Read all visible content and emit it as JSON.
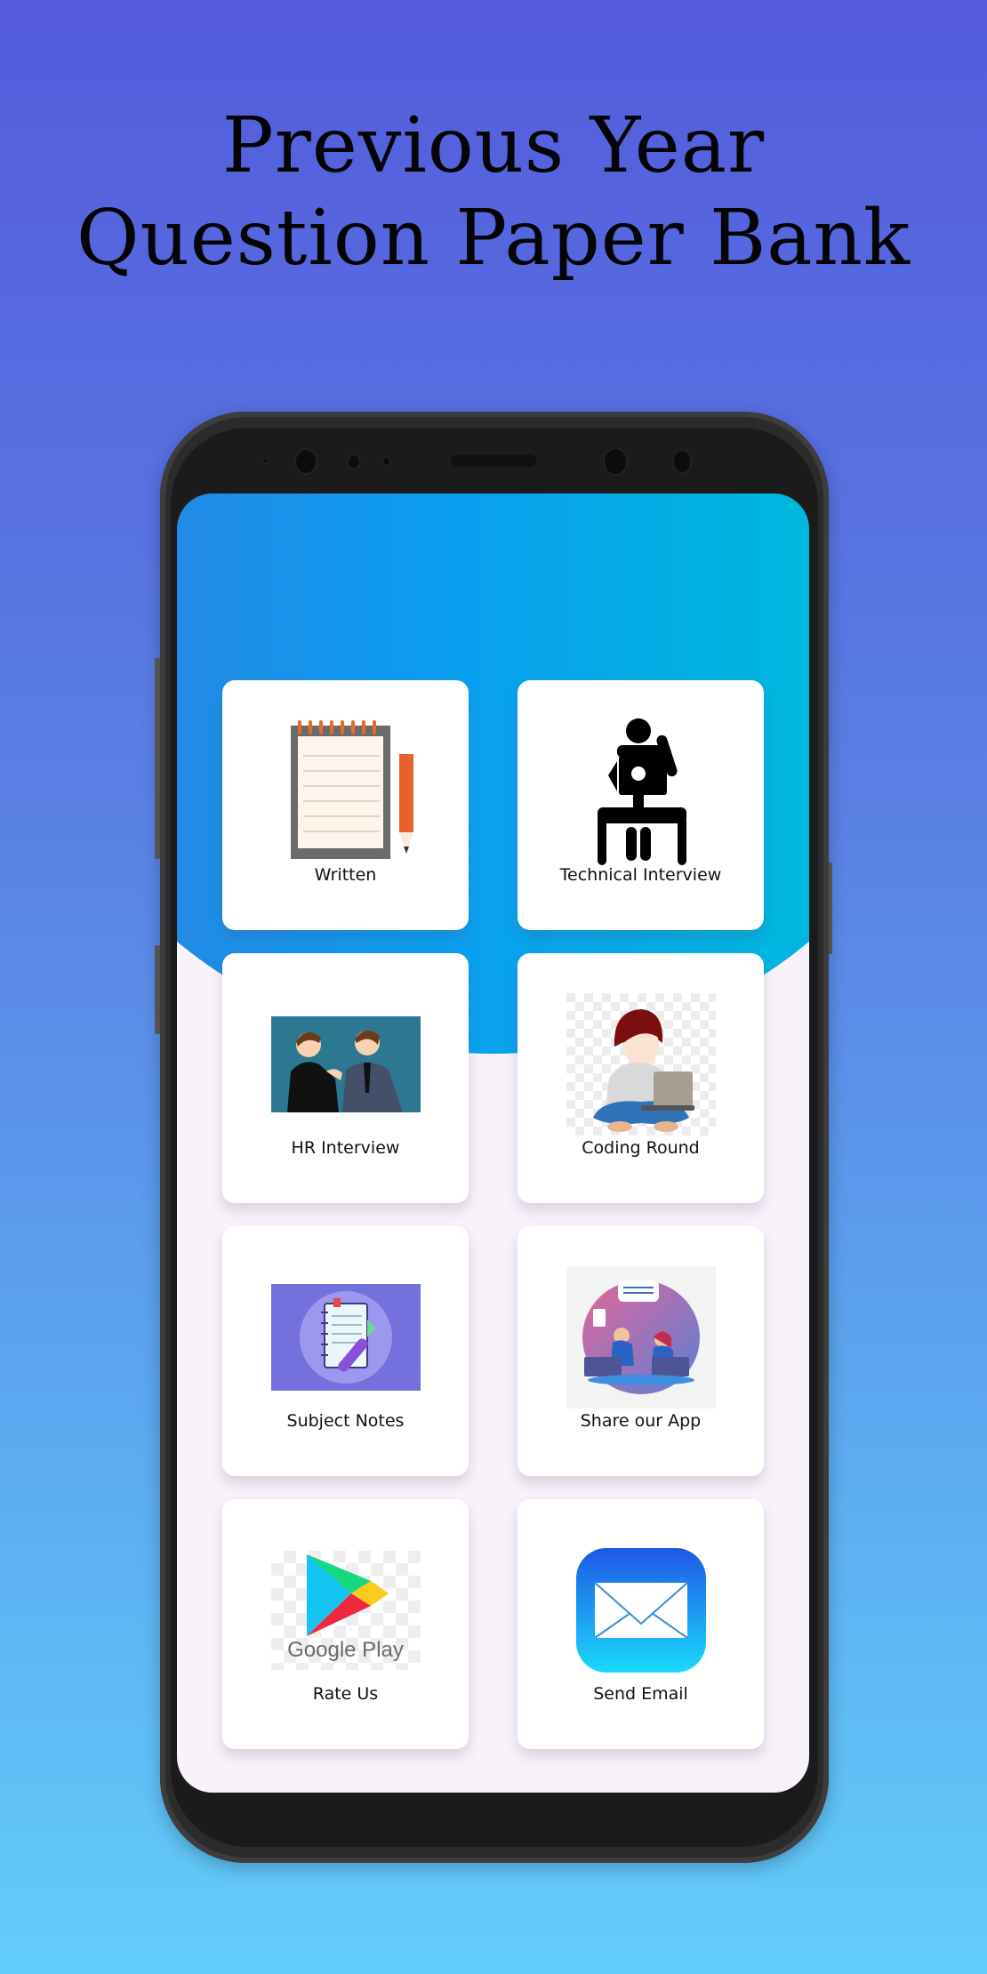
{
  "promo": {
    "headline_line1": "Previous Year",
    "headline_line2": "Question Paper Bank"
  },
  "app": {
    "menu": [
      {
        "id": "written",
        "label": "Written",
        "icon": "notepad-pencil-icon"
      },
      {
        "id": "technical-interview",
        "label": "Technical Interview",
        "icon": "person-laptop-desk-icon"
      },
      {
        "id": "hr-interview",
        "label": "HR Interview",
        "icon": "handshake-business-icon"
      },
      {
        "id": "coding-round",
        "label": "Coding Round",
        "icon": "boy-laptop-icon"
      },
      {
        "id": "subject-notes",
        "label": "Subject Notes",
        "icon": "notebook-pen-icon"
      },
      {
        "id": "share-app",
        "label": "Share our App",
        "icon": "people-chat-icon"
      },
      {
        "id": "rate-us",
        "label": "Rate Us",
        "icon": "google-play-icon"
      },
      {
        "id": "send-email",
        "label": "Send Email",
        "icon": "mail-envelope-icon"
      }
    ],
    "google_play_text": "Google Play"
  },
  "colors": {
    "header_gradient_start": "#2f7fe0",
    "header_gradient_end": "#00bcd4",
    "screen_bg": "#f8f2fb",
    "page_gradient_top": "#545bdc",
    "page_gradient_bottom": "#62cdfa"
  }
}
